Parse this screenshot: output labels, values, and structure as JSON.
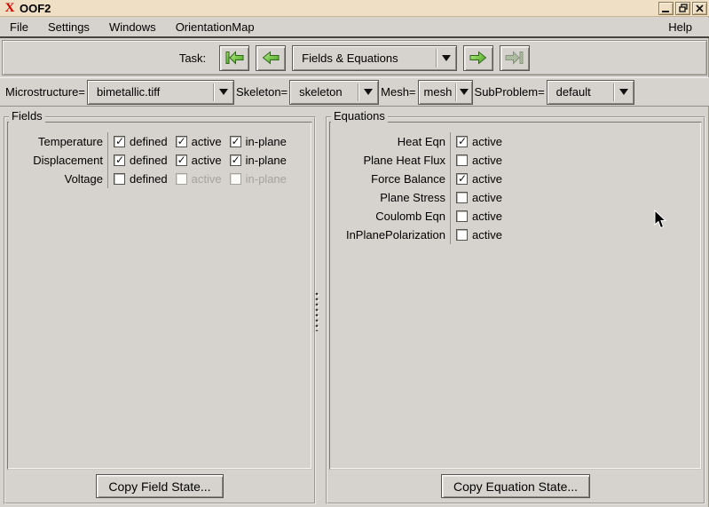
{
  "window": {
    "title": "OOF2"
  },
  "menubar": {
    "items": {
      "file": "File",
      "settings": "Settings",
      "windows": "Windows",
      "orientationmap": "OrientationMap",
      "help": "Help"
    }
  },
  "task": {
    "label": "Task:",
    "selected": "Fields & Equations",
    "nav": {
      "first": "go-first",
      "back": "go-back",
      "next": "go-next",
      "last": "go-last-disabled"
    }
  },
  "context": {
    "microstructure_label": "Microstructure=",
    "microstructure_value": "bimetallic.tiff",
    "skeleton_label": "Skeleton=",
    "skeleton_value": "skeleton",
    "mesh_label": "Mesh=",
    "mesh_value": "mesh",
    "subproblem_label": "SubProblem=",
    "subproblem_value": "default"
  },
  "fields": {
    "title": "Fields",
    "labels": {
      "defined": "defined",
      "active": "active",
      "inplane": "in-plane"
    },
    "rows": [
      {
        "name": "Temperature",
        "defined": true,
        "active": true,
        "inplane": true,
        "enabled": true
      },
      {
        "name": "Displacement",
        "defined": true,
        "active": true,
        "inplane": true,
        "enabled": true
      },
      {
        "name": "Voltage",
        "defined": false,
        "active": false,
        "inplane": false,
        "enabled": false
      }
    ],
    "copy_button": "Copy Field State..."
  },
  "equations": {
    "title": "Equations",
    "active_label": "active",
    "rows": [
      {
        "name": "Heat Eqn",
        "active": true
      },
      {
        "name": "Plane Heat Flux",
        "active": false
      },
      {
        "name": "Force Balance",
        "active": true
      },
      {
        "name": "Plane Stress",
        "active": false
      },
      {
        "name": "Coulomb Eqn",
        "active": false
      },
      {
        "name": "InPlanePolarization",
        "active": false
      }
    ],
    "copy_button": "Copy Equation State..."
  },
  "colors": {
    "titlebar": "#efe0c5",
    "background": "#d6d3ce",
    "arrow_green": "#7cc94e",
    "logo_red": "#d40000"
  }
}
